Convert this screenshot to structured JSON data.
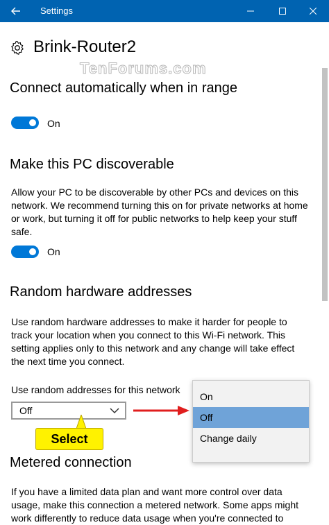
{
  "window": {
    "title": "Settings",
    "back_icon": "back-arrow-icon",
    "minimize_icon": "minimize-icon",
    "maximize_icon": "maximize-icon",
    "close_icon": "close-icon"
  },
  "page": {
    "title": "Brink-Router2",
    "icon": "gear-icon",
    "watermark": "TenForums.com"
  },
  "connect_auto": {
    "heading": "Connect automatically when in range",
    "toggle_state": "On"
  },
  "discoverable": {
    "heading": "Make this PC discoverable",
    "description": "Allow your PC to be discoverable by other PCs and devices on this network. We recommend turning this on for private networks at home or work, but turning it off for public networks to help keep your stuff safe.",
    "toggle_state": "On"
  },
  "random_hw": {
    "heading": "Random hardware addresses",
    "description": "Use random hardware addresses to make it harder for people to track your location when you connect to this Wi-Fi network. This setting applies only to this network and any change will take effect the next time you connect.",
    "dropdown_label": "Use random addresses for this network",
    "dropdown_value": "Off",
    "options": [
      "On",
      "Off",
      "Change daily"
    ],
    "selected_option": "Off"
  },
  "callout": {
    "text": "Select"
  },
  "metered": {
    "heading": "Metered connection",
    "description": "If you have a limited data plan and want more control over data usage, make this connection a metered network. Some apps might work differently to reduce data usage when you're connected to"
  },
  "colors": {
    "accent": "#0078d7",
    "titlebar": "#0063b1",
    "highlight": "#6fa3d8",
    "callout": "#fff200",
    "arrow": "#e01e1e"
  }
}
